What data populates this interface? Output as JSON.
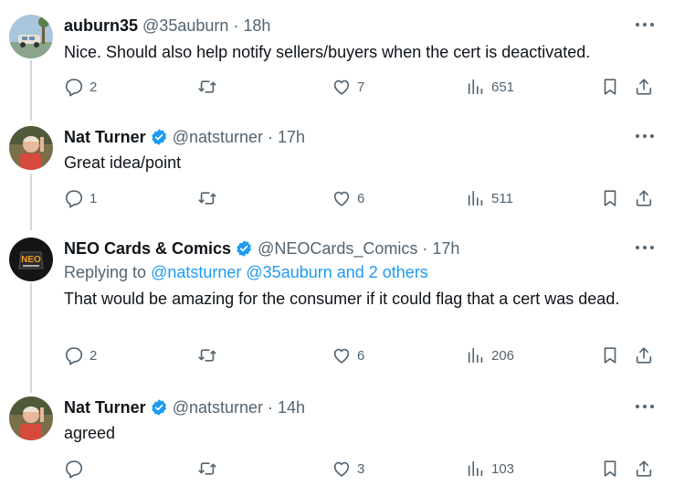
{
  "tweets": [
    {
      "name": "auburn35",
      "handle": "@35auburn",
      "dot": "·",
      "time": "18h",
      "verified": false,
      "text": "Nice. Should also help notify sellers/buyers when the cert is deactivated.",
      "replies": "2",
      "retweets": "",
      "likes": "7",
      "views": "651"
    },
    {
      "name": "Nat Turner",
      "handle": "@natsturner",
      "dot": "·",
      "time": "17h",
      "verified": true,
      "text": "Great idea/point",
      "replies": "1",
      "retweets": "",
      "likes": "6",
      "views": "511"
    },
    {
      "name": "NEO Cards & Comics",
      "handle": "@NEOCards_Comics",
      "dot": "·",
      "time": "17h",
      "verified": true,
      "replying_prefix": "Replying to",
      "replying_to": "@natsturner @35auburn and 2 others",
      "text": "That would be amazing for the consumer if it could flag that a cert was dead.",
      "replies": "2",
      "retweets": "",
      "likes": "6",
      "views": "206"
    },
    {
      "name": "Nat Turner",
      "handle": "@natsturner",
      "dot": "·",
      "time": "14h",
      "verified": true,
      "text": "agreed",
      "replies": "",
      "retweets": "",
      "likes": "3",
      "views": "103"
    }
  ],
  "avatar_logo_text": "NEO",
  "colors": {
    "text": "#0f1419",
    "secondary": "#536471",
    "link": "#1d9bf0",
    "verified": "#1d9bf0",
    "thread_line": "#cfd9de"
  },
  "icons": [
    "reply-icon",
    "retweet-icon",
    "like-icon",
    "views-icon",
    "bookmark-icon",
    "share-icon",
    "more-icon",
    "verified-badge-icon"
  ]
}
